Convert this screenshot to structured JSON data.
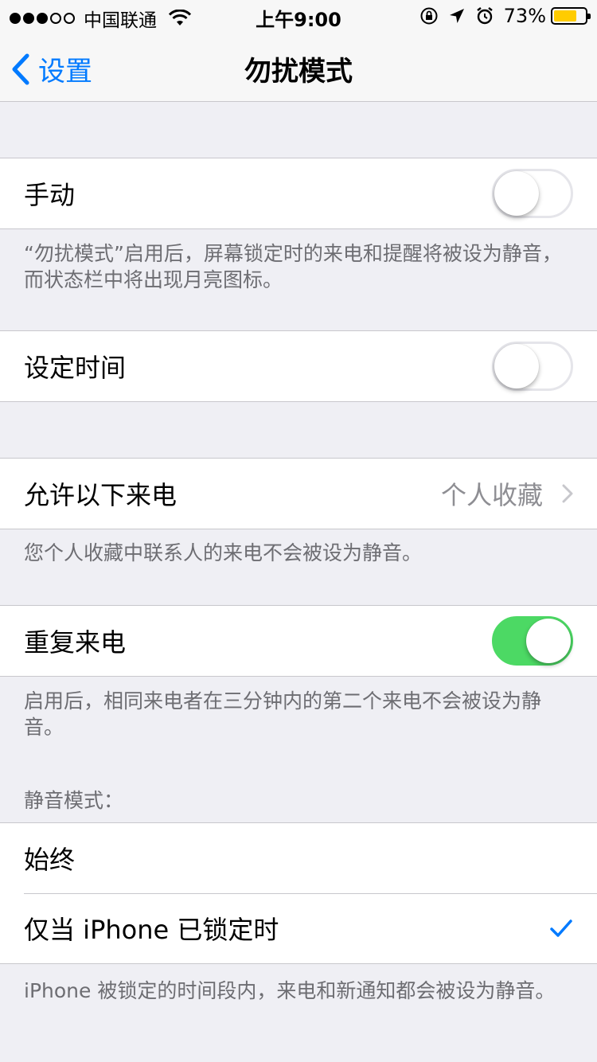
{
  "status_bar": {
    "carrier": "中国联通",
    "time": "上午9:00",
    "battery_percent": "73%",
    "battery_level": 0.73,
    "signal_bars_filled": 3,
    "signal_bars_total": 5,
    "battery_color": "#ffcc00"
  },
  "nav": {
    "back_label": "设置",
    "title": "勿扰模式"
  },
  "manual": {
    "label": "手动",
    "toggle_on": false,
    "footer": "“勿扰模式”启用后，屏幕锁定时的来电和提醒将被设为静音，而状态栏中将出现月亮图标。"
  },
  "scheduled": {
    "label": "设定时间",
    "toggle_on": false
  },
  "allow_calls": {
    "label": "允许以下来电",
    "value": "个人收藏",
    "footer": "您个人收藏中联系人的来电不会被设为静音。"
  },
  "repeated_calls": {
    "label": "重复来电",
    "toggle_on": true,
    "footer": "启用后，相同来电者在三分钟内的第二个来电不会被设为静音。"
  },
  "silence": {
    "header": "静音模式：",
    "options": [
      {
        "label": "始终",
        "selected": false
      },
      {
        "label": "仅当 iPhone 已锁定时",
        "selected": true
      }
    ],
    "footer": "iPhone 被锁定的时间段内，来电和新通知都会被设为静音。"
  },
  "colors": {
    "accent": "#007aff",
    "toggle_on": "#4cd964",
    "background": "#efeff4",
    "footer_text": "#6d6d72"
  }
}
